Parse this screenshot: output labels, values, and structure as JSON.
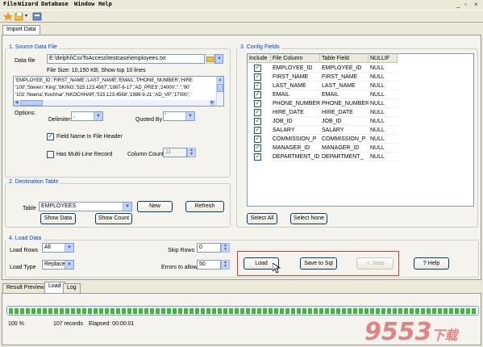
{
  "menu": {
    "items": [
      "File",
      "Wizard",
      "Database",
      "Window",
      "Help"
    ],
    "window_controls": [
      "_",
      "▫",
      "×"
    ]
  },
  "tabs": {
    "main": "Import Data"
  },
  "source": {
    "title": "1. Source Data File",
    "data_file_label": "Data file",
    "data_file_value": "E:\\delphi\\CsvToAccess\\testcase\\employees.txt",
    "file_info": "File Size: 10,150 KB,  Show top 10 lines",
    "preview_lines": [
      "'EMPLOYEE_ID','FIRST_NAME','LAST_NAME','EMAIL','PHONE_NUMBER','HIRE",
      "'100','Steven','King','SKING','515.123.4567','1987-6-17','AD_PRES','24000','','','90'",
      "'101','Neena','Kochhar','NKOCHHAR','515.123.4568','1989-9-21','AD_VP','17000','"
    ],
    "options_label": "Options:",
    "delimiter_label": "Delimiter",
    "delimiter_value": ",",
    "quoted_by_label": "Quoted By",
    "quoted_by_value": "'",
    "field_name_label": "Field Name In File Header",
    "field_name_checked": true,
    "multiline_label": "Has Multi-Line Record",
    "multiline_checked": false,
    "column_count_label": "Column Count",
    "column_count_value": "11"
  },
  "destination": {
    "title": "2. Destination Table",
    "table_label": "Table",
    "table_value": "EMPLOYEES",
    "new_button": "New",
    "refresh_button": "Refresh",
    "show_data_button": "Show Data",
    "show_count_button": "Show Count"
  },
  "config": {
    "title": "3. Config Fields",
    "headers": [
      "Include",
      "File Column",
      "Table Field",
      "NULLIF"
    ],
    "rows": [
      {
        "file_column": "EMPLOYEE_ID",
        "table_field": "EMPLOYEE_ID",
        "nullif": "NULL"
      },
      {
        "file_column": "FIRST_NAME",
        "table_field": "FIRST_NAME",
        "nullif": "NULL"
      },
      {
        "file_column": "LAST_NAME",
        "table_field": "LAST_NAME",
        "nullif": "NULL"
      },
      {
        "file_column": "EMAIL",
        "table_field": "EMAIL",
        "nullif": "NULL"
      },
      {
        "file_column": "PHONE_NUMBER",
        "table_field": "PHONE_NUMBER",
        "nullif": "NULL"
      },
      {
        "file_column": "HIRE_DATE",
        "table_field": "HIRE_DATE",
        "nullif": "NULL"
      },
      {
        "file_column": "JOB_ID",
        "table_field": "JOB_ID",
        "nullif": "NULL"
      },
      {
        "file_column": "SALARY",
        "table_field": "SALARY",
        "nullif": "NULL"
      },
      {
        "file_column": "COMMISSION_P",
        "table_field": "COMMISSION_P",
        "nullif": "NULL"
      },
      {
        "file_column": "MANAGER_ID",
        "table_field": "MANAGER_ID",
        "nullif": "NULL"
      },
      {
        "file_column": "DEPARTMENT_ID",
        "table_field": "DEPARTMENT_",
        "nullif": "NULL"
      }
    ],
    "select_all_button": "Select All",
    "select_none_button": "Select None"
  },
  "load": {
    "title": "4. Load Data",
    "load_rows_label": "Load Rows",
    "load_rows_value": "All",
    "load_type_label": "Load Type",
    "load_type_value": "Replace",
    "skip_rows_label": "Skip Rows",
    "skip_rows_value": "0",
    "errors_label": "Errors to allow",
    "errors_value": "50",
    "load_button": "Load",
    "save_sql_button": "Save to Sql",
    "stop_button": "Stop",
    "help_button": "Help",
    "help_mnemonic": "H"
  },
  "bottom_tabs": [
    "Result Preview",
    "Load",
    "Log"
  ],
  "status": {
    "progress_percent": 100,
    "percent_text": "100 %",
    "records_text": "107 records",
    "elapsed_text": "Elapsed: 00:00:01"
  },
  "watermark": {
    "brand": "9553",
    "suffix": "下载"
  },
  "colors": {
    "group_title": "#0046d5",
    "progress": "#3cb83c",
    "highlight": "#e23a2e"
  }
}
